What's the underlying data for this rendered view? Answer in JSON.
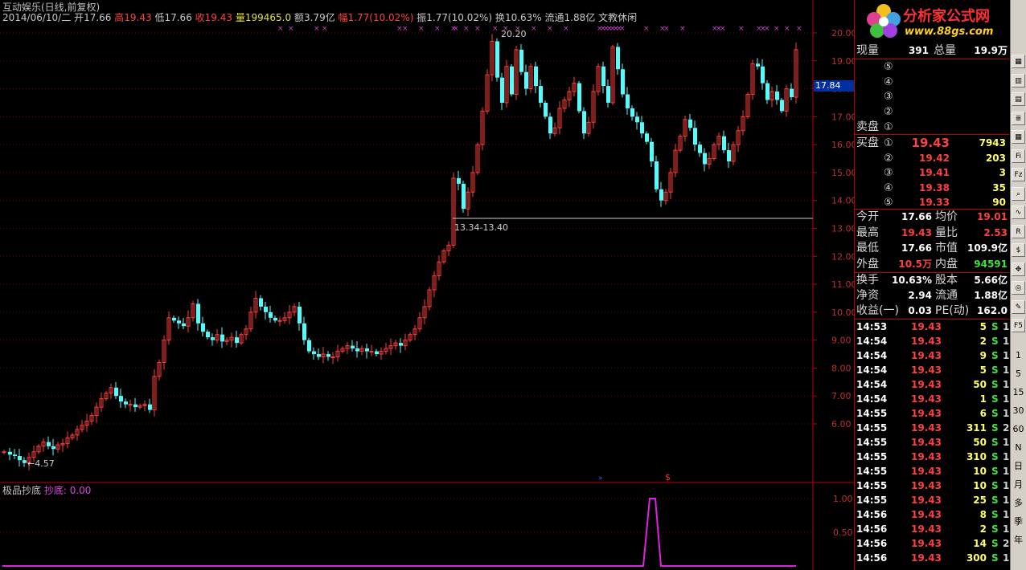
{
  "header": {
    "title": "互动娱乐(日线,前复权)",
    "date": "2014/06/10/二",
    "open_label": "开",
    "open": "17.66",
    "high_label": "高",
    "high": "19.43",
    "low_label": "低",
    "low": "17.66",
    "close_label": "收",
    "close": "19.43",
    "vol_label": "量",
    "vol": "199465.0",
    "amount_label": "额",
    "amount": "3.79亿",
    "change_label": "幅",
    "change": "1.77(10.02%)",
    "amp_label": "振",
    "amp": "1.77(10.02%)",
    "turn_label": "换",
    "turn": "10.63%",
    "float_label": "流通",
    "float": "1.88亿",
    "sector": "文教休闲"
  },
  "price_axis": [
    "20.00",
    "19.00",
    "18.00",
    "17.00",
    "16.00",
    "15.00",
    "14.00",
    "13.00",
    "12.00",
    "11.00",
    "10.00",
    "9.00",
    "8.00",
    "7.00",
    "6.00"
  ],
  "current_price_label": "17.84",
  "annotations": {
    "peak": "20.20",
    "low": "4.57",
    "range": "13.34-13.40",
    "signal_marker": "$"
  },
  "indicator": {
    "name": "极品抄底",
    "series_label": "抄底:",
    "series_value": "0.00",
    "axis": [
      "1.00",
      "0.50"
    ]
  },
  "chart_data": {
    "type": "candlestick",
    "title": "互动娱乐(日线,前复权)",
    "ylim": [
      4.0,
      20.6
    ],
    "last": {
      "date": "2014/06/10",
      "open": 17.66,
      "high": 19.43,
      "low": 17.66,
      "close": 19.43
    }
  },
  "panel": {
    "logo_text": "分析家公式网",
    "logo_url": "www.88gs.com",
    "now_vol_label": "现量",
    "now_vol": "391",
    "total_vol_label": "总量",
    "total_vol": "19.9万",
    "sell_label": "卖盘",
    "buy_label": "买盘",
    "sell": [
      {
        "idx": "⑤",
        "price": "",
        "vol": ""
      },
      {
        "idx": "④",
        "price": "",
        "vol": ""
      },
      {
        "idx": "③",
        "price": "",
        "vol": ""
      },
      {
        "idx": "②",
        "price": "",
        "vol": ""
      },
      {
        "idx": "①",
        "price": "",
        "vol": ""
      }
    ],
    "buy": [
      {
        "idx": "①",
        "price": "19.43",
        "vol": "7943"
      },
      {
        "idx": "②",
        "price": "19.42",
        "vol": "203"
      },
      {
        "idx": "③",
        "price": "19.41",
        "vol": "3"
      },
      {
        "idx": "④",
        "price": "19.38",
        "vol": "35"
      },
      {
        "idx": "⑤",
        "price": "19.33",
        "vol": "90"
      }
    ],
    "stats": [
      {
        "l1": "今开",
        "v1": "17.66",
        "c1": "#ffffff",
        "l2": "均价",
        "v2": "19.01",
        "c2": "#ff4040"
      },
      {
        "l1": "最高",
        "v1": "19.43",
        "c1": "#ff4040",
        "l2": "量比",
        "v2": "2.53",
        "c2": "#ff4040"
      },
      {
        "l1": "最低",
        "v1": "17.66",
        "c1": "#ffffff",
        "l2": "市值",
        "v2": "109.9亿",
        "c2": "#ffffff"
      },
      {
        "l1": "外盘",
        "v1": "10.5万",
        "c1": "#ff4040",
        "l2": "内盘",
        "v2": "94591",
        "c2": "#40e040"
      }
    ],
    "fund": [
      {
        "l1": "换手",
        "v1": "10.63%",
        "l2": "股本",
        "v2": "5.66亿"
      },
      {
        "l1": "净资",
        "v1": "2.94",
        "l2": "流通",
        "v2": "1.88亿"
      },
      {
        "l1": "收益(一)",
        "v1": "0.03",
        "l2": "PE(动)",
        "v2": "162.0"
      }
    ],
    "ticks": [
      {
        "t": "14:53",
        "p": "19.43",
        "v": "5",
        "s": "S",
        "n": "1"
      },
      {
        "t": "14:54",
        "p": "19.43",
        "v": "2",
        "s": "S",
        "n": "1"
      },
      {
        "t": "14:54",
        "p": "19.43",
        "v": "9",
        "s": "S",
        "n": "1"
      },
      {
        "t": "14:54",
        "p": "19.43",
        "v": "5",
        "s": "S",
        "n": "1"
      },
      {
        "t": "14:54",
        "p": "19.43",
        "v": "50",
        "s": "S",
        "n": "1"
      },
      {
        "t": "14:54",
        "p": "19.43",
        "v": "1",
        "s": "S",
        "n": "1"
      },
      {
        "t": "14:55",
        "p": "19.43",
        "v": "6",
        "s": "S",
        "n": "1"
      },
      {
        "t": "14:55",
        "p": "19.43",
        "v": "311",
        "s": "S",
        "n": "2"
      },
      {
        "t": "14:55",
        "p": "19.43",
        "v": "50",
        "s": "S",
        "n": "1"
      },
      {
        "t": "14:55",
        "p": "19.43",
        "v": "310",
        "s": "S",
        "n": "1"
      },
      {
        "t": "14:55",
        "p": "19.43",
        "v": "10",
        "s": "S",
        "n": "1"
      },
      {
        "t": "14:55",
        "p": "19.43",
        "v": "10",
        "s": "S",
        "n": "1"
      },
      {
        "t": "14:55",
        "p": "19.43",
        "v": "25",
        "s": "S",
        "n": "1"
      },
      {
        "t": "14:56",
        "p": "19.43",
        "v": "8",
        "s": "S",
        "n": "1"
      },
      {
        "t": "14:56",
        "p": "19.43",
        "v": "2",
        "s": "S",
        "n": "1"
      },
      {
        "t": "14:56",
        "p": "19.43",
        "v": "14",
        "s": "S",
        "n": "2"
      },
      {
        "t": "14:56",
        "p": "19.43",
        "v": "300",
        "s": "S",
        "n": "1"
      }
    ]
  },
  "toolbar": {
    "icons": [
      "chart-icon",
      "kline-icon",
      "table-icon",
      "list-icon",
      "grid-icon",
      "fiz-icon",
      "fiz2-icon",
      "zoom-icon",
      "wave-icon",
      "rsi-icon",
      "dollar-icon",
      "move-icon",
      "target-icon",
      "pen-icon",
      "f5-icon"
    ],
    "labels": [
      "1",
      "5",
      "15",
      "30",
      "60",
      "N",
      "日",
      "月",
      "多",
      "季",
      "年"
    ]
  }
}
